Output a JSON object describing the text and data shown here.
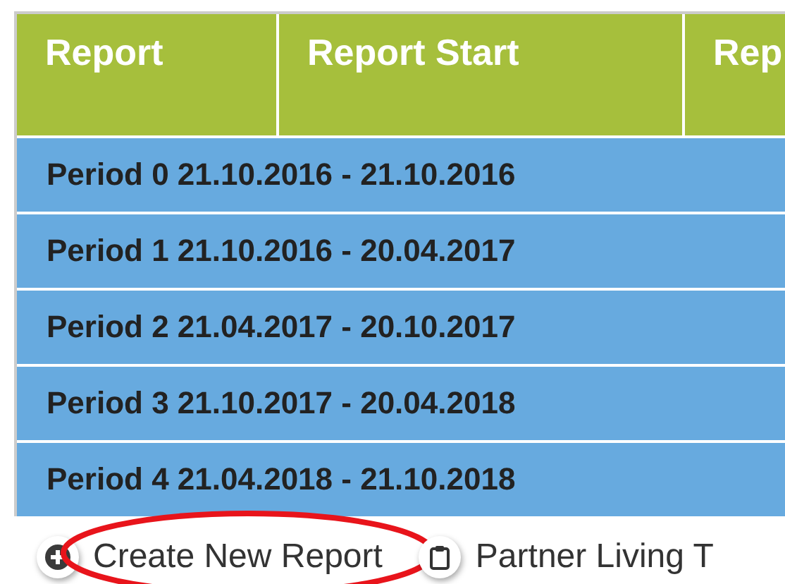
{
  "table": {
    "columns": [
      "Report",
      "Report Start",
      "Rep"
    ],
    "rows": [
      "Period 0 21.10.2016 - 21.10.2016",
      "Period 1 21.10.2016 - 20.04.2017",
      "Period 2 21.04.2017 - 20.10.2017",
      "Period 3 21.10.2017 - 20.04.2018",
      "Period 4 21.04.2018 - 21.10.2018"
    ]
  },
  "actions": [
    {
      "kind": "create",
      "label": "Create New Report",
      "circled": true
    },
    {
      "kind": "clipboard",
      "label": "Partner Living T",
      "circled": false
    }
  ]
}
